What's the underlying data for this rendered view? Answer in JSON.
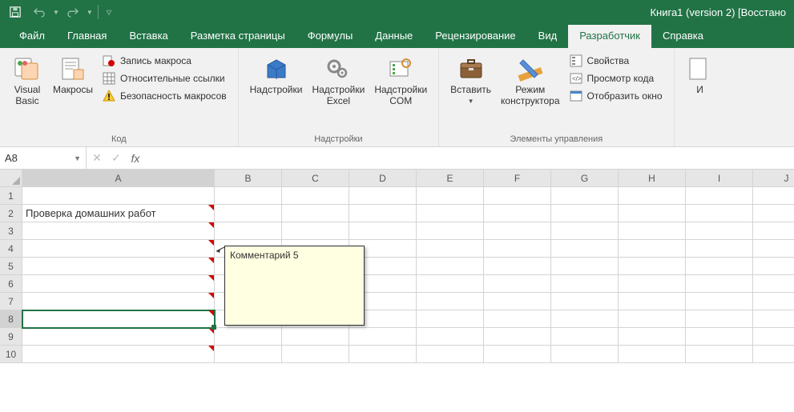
{
  "title": "Книга1 (version 2) [Восстано",
  "tabs": [
    "Файл",
    "Главная",
    "Вставка",
    "Разметка страницы",
    "Формулы",
    "Данные",
    "Рецензирование",
    "Вид",
    "Разработчик",
    "Справка"
  ],
  "activeTab": 8,
  "ribbon": {
    "group1": {
      "label": "Код",
      "vb": "Visual\nBasic",
      "macros": "Макросы",
      "record": "Запись макроса",
      "relative": "Относительные ссылки",
      "security": "Безопасность макросов"
    },
    "group2": {
      "label": "Надстройки",
      "addins": "Надстройки",
      "excel": "Надстройки\nExcel",
      "com": "Надстройки\nCOM"
    },
    "group3": {
      "label": "Элементы управления",
      "insert": "Вставить",
      "design": "Режим\nконструктора",
      "props": "Свойства",
      "code": "Просмотр кода",
      "dialog": "Отобразить окно"
    },
    "group4_first": "И"
  },
  "namebox": "A8",
  "columns": [
    "A",
    "B",
    "C",
    "D",
    "E",
    "F",
    "G",
    "H",
    "I",
    "J"
  ],
  "rows": [
    "1",
    "2",
    "3",
    "4",
    "5",
    "6",
    "7",
    "8",
    "9",
    "10"
  ],
  "activeCell": {
    "row": 8,
    "col": 1
  },
  "data": {
    "A2": "Проверка домашних работ"
  },
  "comments": {
    "indicators": [
      "A2",
      "A3",
      "A4",
      "A5",
      "A6",
      "A7",
      "A8",
      "A9",
      "A10"
    ],
    "visible": {
      "text": "Комментарий 5"
    }
  }
}
